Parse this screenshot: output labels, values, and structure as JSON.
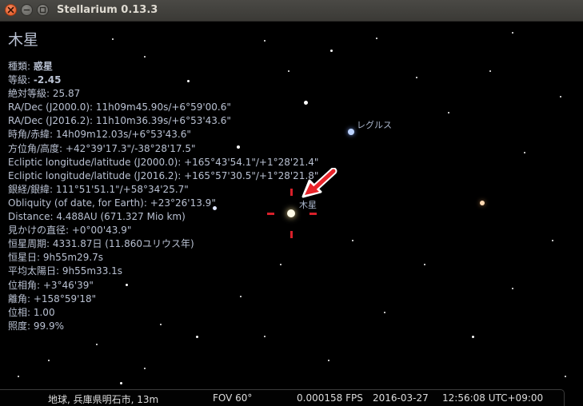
{
  "window": {
    "title": "Stellarium 0.13.3"
  },
  "object_info": {
    "name": "木星",
    "lines": [
      {
        "label": "種類: ",
        "value": "惑星",
        "bold": true
      },
      {
        "label": "等級: ",
        "value": "-2.45",
        "bold": true
      },
      {
        "label": "絶対等級: ",
        "value": "25.87",
        "bold": false
      },
      {
        "label": "RA/Dec (J2000.0): ",
        "value": "11h09m45.90s/+6°59'00.6\"",
        "bold": false
      },
      {
        "label": "RA/Dec (J2016.2): ",
        "value": "11h10m36.39s/+6°53'43.6\"",
        "bold": false
      },
      {
        "label": "時角/赤緯: ",
        "value": "14h09m12.03s/+6°53'43.6\"",
        "bold": false
      },
      {
        "label": "方位角/高度: ",
        "value": "+42°39'17.3\"/-38°28'17.5\"",
        "bold": false
      },
      {
        "label": "Ecliptic longitude/latitude (J2000.0): ",
        "value": "+165°43'54.1\"/+1°28'21.4\"",
        "bold": false
      },
      {
        "label": "Ecliptic longitude/latitude (J2016.2): ",
        "value": "+165°57'30.5\"/+1°28'21.8\"",
        "bold": false
      },
      {
        "label": "銀経/銀緯: ",
        "value": "111°51'51.1\"/+58°34'25.7\"",
        "bold": false
      },
      {
        "label": "Obliquity (of date, for Earth): ",
        "value": "+23°26'13.9\"",
        "bold": false
      },
      {
        "label": "Distance: ",
        "value": "4.488AU (671.327 Mio km)",
        "bold": false
      },
      {
        "label": "見かけの直径: ",
        "value": "+0°00'43.9\"",
        "bold": false
      },
      {
        "label": "恒星周期: ",
        "value": "4331.87日 (11.860ユリウス年)",
        "bold": false
      },
      {
        "label": "恒星日: ",
        "value": "9h55m29.7s",
        "bold": false
      },
      {
        "label": "平均太陽日: ",
        "value": "9h55m33.1s",
        "bold": false
      },
      {
        "label": "位相角: ",
        "value": "+3°46'39\"",
        "bold": false
      },
      {
        "label": "離角: ",
        "value": "+158°59'18\"",
        "bold": false
      },
      {
        "label": "位相: ",
        "value": "1.00",
        "bold": false
      },
      {
        "label": "照度: ",
        "value": "99.9%",
        "bold": false
      }
    ]
  },
  "sky_labels": {
    "regulus": "レグルス",
    "jupiter": "木星"
  },
  "status_bar": {
    "location": "地球, 兵庫県明石市, 13m",
    "fov": "FOV 60°",
    "fps": "0.000158 FPS",
    "date": "2016-03-27",
    "time": "12:56:08 UTC+09:00"
  },
  "colors": {
    "info_text": "#b9c1d2",
    "reticle": "#d8202a",
    "arrow": "#e8242a",
    "sky": "#000000"
  },
  "icons": {
    "close": "close-icon",
    "minimize": "minimize-icon",
    "maximize": "maximize-icon",
    "pointer": "red-arrow-icon"
  }
}
